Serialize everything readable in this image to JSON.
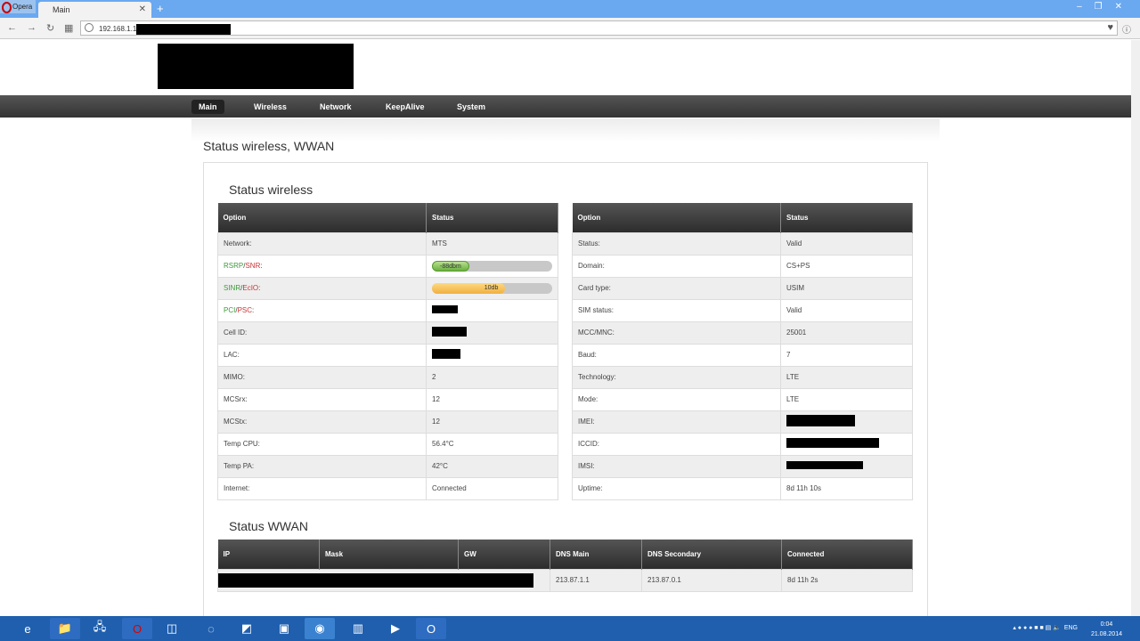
{
  "browser": {
    "opera_label": "Opera",
    "tab_title": "Main",
    "url": "192.168.1.1"
  },
  "menu": [
    "Main",
    "Wireless",
    "Network",
    "KeepAlive",
    "System"
  ],
  "page_title": "Status wireless, WWAN",
  "wireless": {
    "heading": "Status wireless",
    "col_option": "Option",
    "col_status": "Status",
    "left": [
      {
        "label": "Network:",
        "value": "MTS"
      },
      {
        "label_a": "RSRP",
        "label_b": "SNR",
        "label_end": ":",
        "value": "-88dbm",
        "fill_pct": 31
      },
      {
        "label_a": "SINR",
        "label_b": "EcIO",
        "label_end": ":",
        "value": "10db",
        "fill_pct": 61
      },
      {
        "label_a": "PCI",
        "label_b": "PSC",
        "label_end": ":"
      },
      {
        "label": "Cell ID:"
      },
      {
        "label": "LAC:"
      },
      {
        "label": "MIMO:",
        "value": "2"
      },
      {
        "label": "MCSrx:",
        "value": "12"
      },
      {
        "label": "MCStx:",
        "value": "12"
      },
      {
        "label": "Temp CPU:",
        "value": "56.4°C"
      },
      {
        "label": "Temp PA:",
        "value": "42°C"
      },
      {
        "label": "Internet:",
        "value": "Connected"
      }
    ],
    "right": [
      {
        "label": "Status:",
        "value": "Valid"
      },
      {
        "label": "Domain:",
        "value": "CS+PS"
      },
      {
        "label": "Card type:",
        "value": "USIM"
      },
      {
        "label": "SIM status:",
        "value": "Valid"
      },
      {
        "label": "MCC/MNC:",
        "value": "25001"
      },
      {
        "label": "Baud:",
        "value": "7"
      },
      {
        "label": "Technology:",
        "value": "LTE"
      },
      {
        "label": "Mode:",
        "value": "LTE"
      },
      {
        "label": "IMEI:"
      },
      {
        "label": "ICCID:"
      },
      {
        "label": "IMSI:"
      },
      {
        "label": "Uptime:",
        "value": "8d 11h 10s"
      }
    ]
  },
  "wwan": {
    "heading": "Status WWAN",
    "cols": [
      "IP",
      "Mask",
      "GW",
      "DNS Main",
      "DNS Secondary",
      "Connected"
    ],
    "row": {
      "dns_main": "213.87.1.1",
      "dns_secondary": "213.87.0.1",
      "connected": "8d 11h 2s"
    }
  },
  "taskbar": {
    "lang": "ENG",
    "time": "0:04",
    "date": "21.08.2014"
  }
}
